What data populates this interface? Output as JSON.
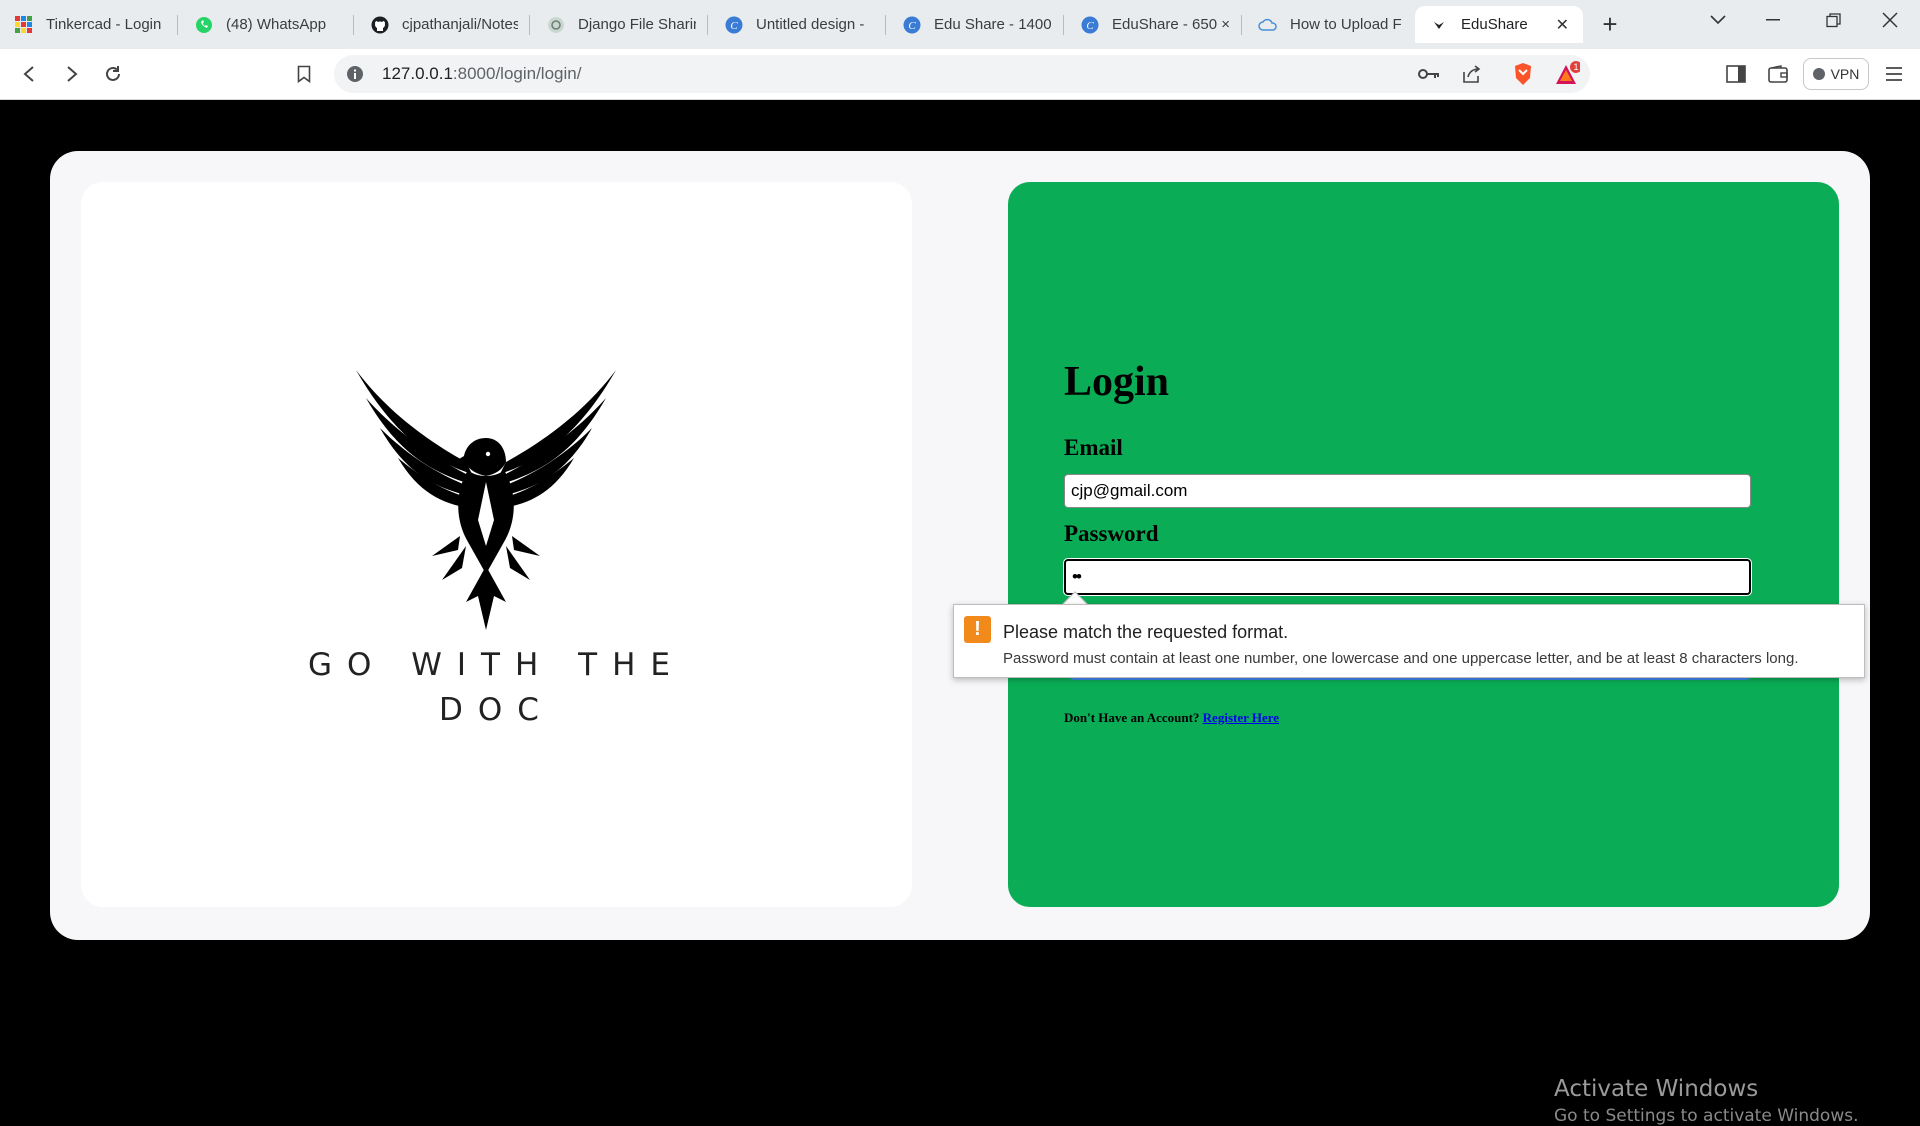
{
  "browser": {
    "tabs": [
      {
        "title": "Tinkercad - Login",
        "icon": "tinkercad-icon"
      },
      {
        "title": "(48) WhatsApp",
        "icon": "whatsapp-icon"
      },
      {
        "title": "cjpathanjali/Notes",
        "icon": "github-icon"
      },
      {
        "title": "Django File Sharin",
        "icon": "chatgpt-icon"
      },
      {
        "title": "Untitled design - ",
        "icon": "canva-icon"
      },
      {
        "title": "Edu Share - 1400",
        "icon": "canva-icon"
      },
      {
        "title": "EduShare - 650 ×",
        "icon": "canva-icon"
      },
      {
        "title": "How to Upload Fil",
        "icon": "cloud-icon"
      },
      {
        "title": "EduShare",
        "icon": "edushare-icon",
        "active": true
      }
    ],
    "new_tab_label": "+",
    "url_host": "127.0.0.1",
    "url_path": ":8000/login/login/",
    "vpn_label": "VPN",
    "brave_badge": "1",
    "accent": "#1a73e8"
  },
  "left_panel": {
    "logo_line1": "GO WITH THE",
    "logo_line2": "DOC"
  },
  "login": {
    "title": "Login",
    "email_label": "Email",
    "email_value": "cjp@gmail.com",
    "password_label": "Password",
    "password_value": "••",
    "register_prompt": "Don't Have an Account?",
    "register_link": "Register Here",
    "panel_color": "#0aad56",
    "button_color": "#4285f4"
  },
  "validation": {
    "title": "Please match the requested format.",
    "message": "Password must contain at least one number, one lowercase and one uppercase letter, and be at least 8 characters long."
  },
  "os_watermark": {
    "line1": "Activate Windows",
    "line2": "Go to Settings to activate Windows."
  }
}
